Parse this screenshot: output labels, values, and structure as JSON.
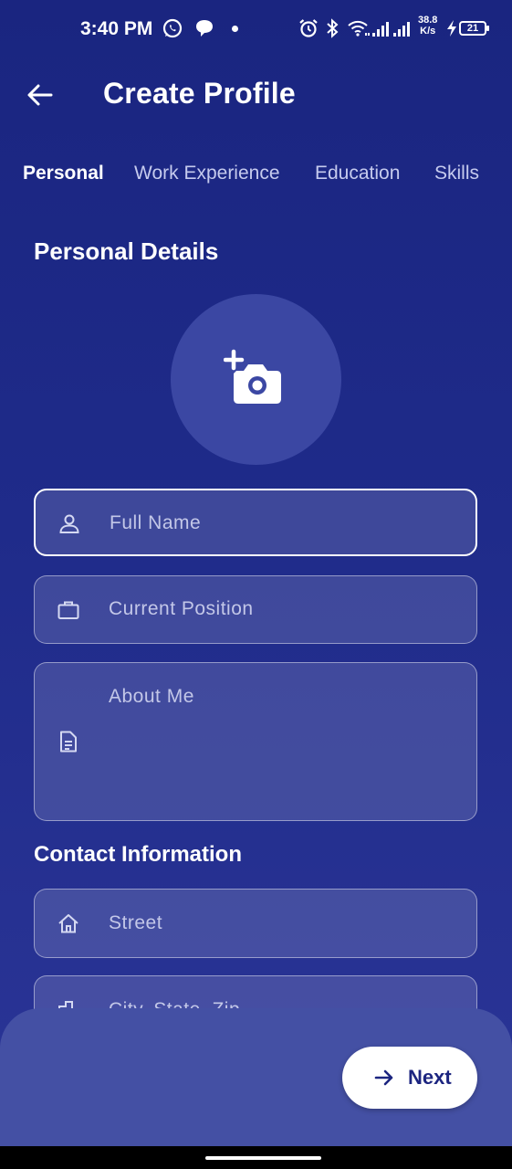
{
  "status_bar": {
    "time": "3:40 PM",
    "network_speed_value": "38.8",
    "network_speed_unit": "K/s",
    "battery_level": "21",
    "icons": [
      "whatsapp-icon",
      "chat-bubble-icon",
      "alarm-icon",
      "bluetooth-icon",
      "wifi-icon",
      "signal-icon",
      "charging-icon",
      "battery-icon"
    ]
  },
  "app_bar": {
    "title": "Create Profile",
    "back_icon": "arrow-back-icon"
  },
  "tabs": [
    {
      "label": "Personal",
      "active": true
    },
    {
      "label": "Work Experience",
      "active": false
    },
    {
      "label": "Education",
      "active": false
    },
    {
      "label": "Skills",
      "active": false
    }
  ],
  "personal_details": {
    "heading": "Personal Details",
    "photo_icon": "add-photo-icon",
    "fields": [
      {
        "placeholder": "Full Name",
        "icon": "person-icon",
        "focused": true
      },
      {
        "placeholder": "Current Position",
        "icon": "briefcase-icon",
        "focused": false
      },
      {
        "placeholder": "About Me",
        "icon": "document-icon",
        "focused": false
      }
    ]
  },
  "contact_information": {
    "heading": "Contact Information",
    "fields": [
      {
        "placeholder": "Street",
        "icon": "home-icon"
      },
      {
        "placeholder": "City, State, Zip",
        "icon": "city-icon"
      }
    ]
  },
  "footer": {
    "next_label": "Next",
    "next_icon": "arrow-forward-icon"
  },
  "colors": {
    "background": "#1f2b8a",
    "field_fill": "#3f4a9f",
    "bottom_sheet": "#4450a4",
    "button_text": "#1c2580"
  }
}
